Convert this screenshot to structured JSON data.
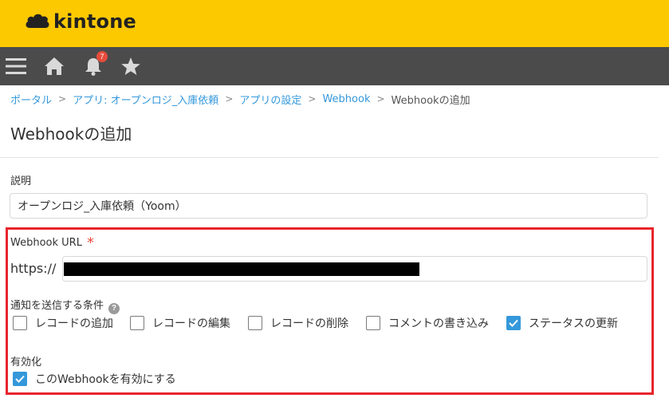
{
  "app": {
    "logo_text": "kintone"
  },
  "nav": {
    "notifications_count": "7",
    "icons": [
      "menu-icon",
      "home-icon",
      "bell-icon",
      "star-icon"
    ]
  },
  "breadcrumb": {
    "items": [
      "ポータル",
      "アプリ: オープンロジ_入庫依頼",
      "アプリの設定",
      "Webhook"
    ],
    "current": "Webhookの追加",
    "separator": ">"
  },
  "page": {
    "title": "Webhookの追加"
  },
  "form": {
    "description": {
      "label": "説明",
      "value": "オープンロジ_入庫依頼（Yoom）"
    },
    "url": {
      "label": "Webhook URL",
      "required_mark": "*",
      "prefix": "https://"
    },
    "conditions": {
      "label": "通知を送信する条件",
      "help": "?",
      "options": [
        {
          "label": "レコードの追加",
          "checked": false
        },
        {
          "label": "レコードの編集",
          "checked": false
        },
        {
          "label": "レコードの削除",
          "checked": false
        },
        {
          "label": "コメントの書き込み",
          "checked": false
        },
        {
          "label": "ステータスの更新",
          "checked": true
        }
      ]
    },
    "enabled": {
      "label": "有効化",
      "checkbox_label": "このWebhookを有効にする",
      "checked": true
    }
  },
  "colors": {
    "header_bg": "#fcc800",
    "nav_bg": "#4b4b4b",
    "link": "#3498db",
    "checkbox_checked": "#3498db",
    "highlight_border": "#e8242c",
    "required": "#e74c3c",
    "badge": "#e64c3c"
  }
}
